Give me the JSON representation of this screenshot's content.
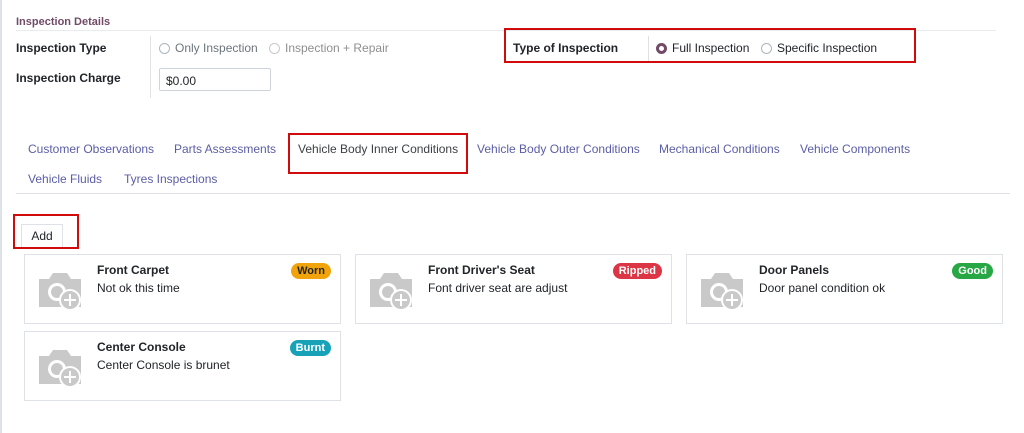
{
  "section": {
    "title": "Inspection Details"
  },
  "fields": {
    "inspection_type_label": "Inspection Type",
    "inspection_type_options": [
      "Only Inspection",
      "Inspection + Repair"
    ],
    "inspection_charge_label": "Inspection Charge",
    "inspection_charge_value": "$0.00",
    "type_of_inspection_label": "Type of Inspection",
    "type_of_inspection_options": [
      "Full Inspection",
      "Specific Inspection"
    ],
    "type_of_inspection_selected": "Full Inspection"
  },
  "tabs": [
    {
      "label": "Customer Observations"
    },
    {
      "label": "Parts Assessments"
    },
    {
      "label": "Vehicle Body Inner Conditions"
    },
    {
      "label": "Vehicle Body Outer Conditions"
    },
    {
      "label": "Mechanical Conditions"
    },
    {
      "label": "Vehicle Components"
    },
    {
      "label": "Vehicle Fluids"
    },
    {
      "label": "Tyres Inspections"
    }
  ],
  "active_tab": "Vehicle Body Inner Conditions",
  "add_button": "Add",
  "cards": [
    {
      "title": "Front Carpet",
      "description": "Not ok this time",
      "badge": "Worn",
      "badge_color": "#f0a30a"
    },
    {
      "title": "Front Driver's Seat",
      "description": "Font driver seat are adjust",
      "badge": "Ripped",
      "badge_color": "#dc3545"
    },
    {
      "title": "Door Panels",
      "description": "Door panel condition ok",
      "badge": "Good",
      "badge_color": "#28a745"
    },
    {
      "title": "Center Console",
      "description": "Center Console is brunet",
      "badge": "Burnt",
      "badge_color": "#17a2b8"
    }
  ],
  "colors": {
    "accent": "#714B67",
    "link": "#5b5ea6",
    "highlight": "#d10b0b"
  }
}
